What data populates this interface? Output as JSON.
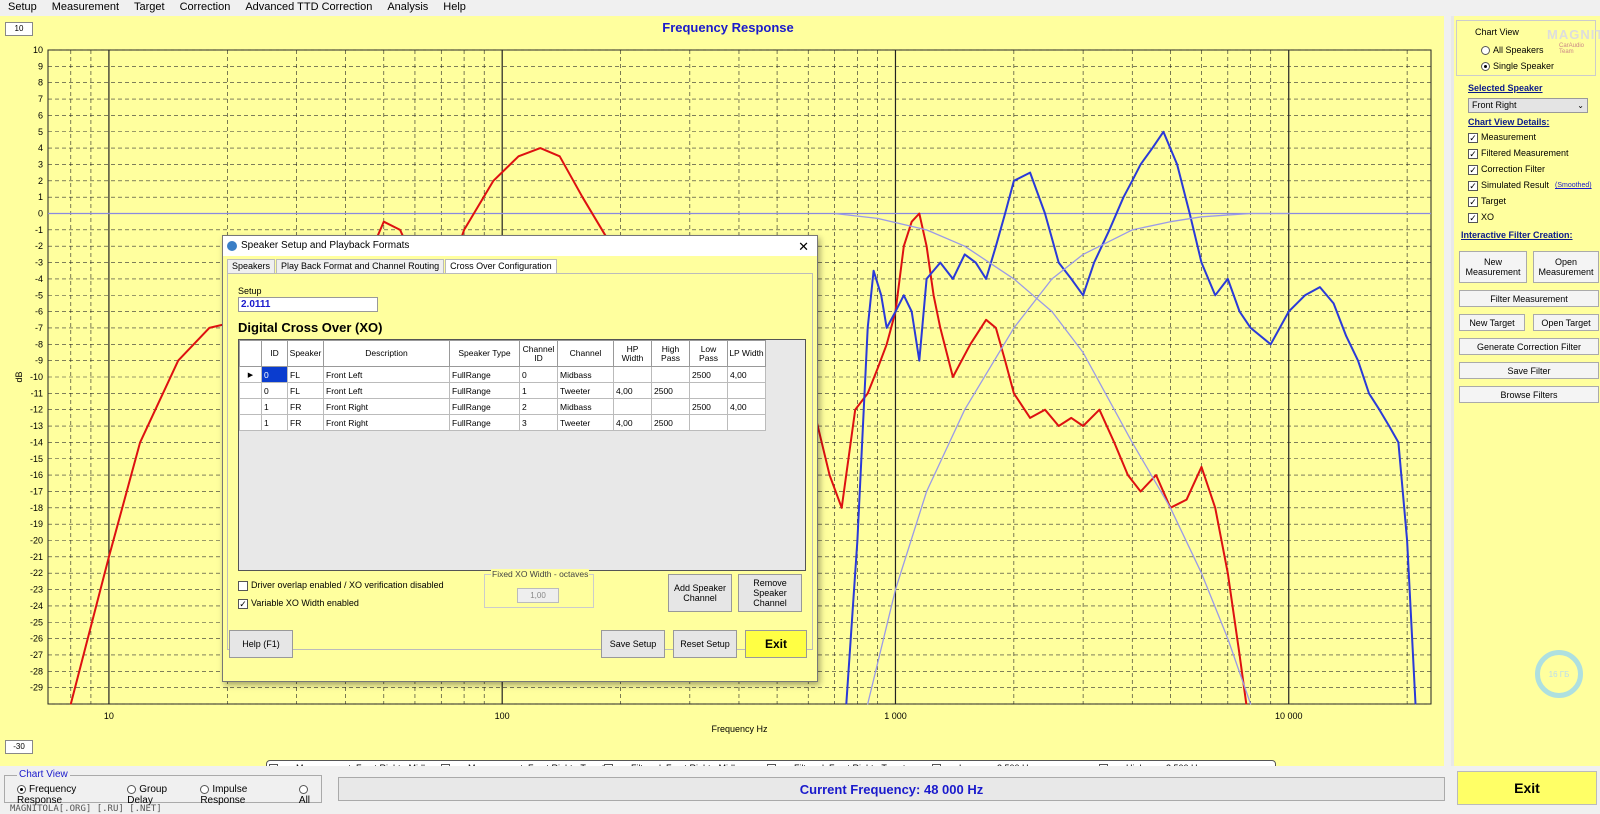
{
  "menu": [
    "Setup",
    "Measurement",
    "Target",
    "Correction",
    "Advanced TTD Correction",
    "Analysis",
    "Help"
  ],
  "chart": {
    "title": "Frequency Response",
    "ymax_box": "10",
    "ymin_box": "-30",
    "ylabel": "dB",
    "xlabel": "Frequency Hz",
    "y_ticks": [
      "10",
      "9",
      "8",
      "7",
      "6",
      "5",
      "4",
      "3",
      "2",
      "1",
      "0",
      "-1",
      "-2",
      "-3",
      "-4",
      "-5",
      "-6",
      "-7",
      "-8",
      "-9",
      "-10",
      "-11",
      "-12",
      "-13",
      "-14",
      "-15",
      "-16",
      "-17",
      "-18",
      "-19",
      "-20",
      "-21",
      "-22",
      "-23",
      "-24",
      "-25",
      "-26",
      "-27",
      "-28",
      "-29"
    ],
    "x_ticks": [
      "10",
      "100",
      "1 000",
      "10 000"
    ]
  },
  "chart_data": {
    "type": "line",
    "title": "Frequency Response",
    "xlabel": "Frequency Hz",
    "ylabel": "dB",
    "x_scale": "log",
    "xlim": [
      7,
      23000
    ],
    "ylim": [
      -30,
      10
    ],
    "grid": true,
    "legend_position": "bottom",
    "series": [
      {
        "name": "Filtered: Front Right - Midbass",
        "color": "#dd1111",
        "x": [
          8,
          10,
          12,
          15,
          18,
          22,
          26,
          34,
          42,
          46,
          50,
          55,
          60,
          65,
          70,
          80,
          95,
          110,
          125,
          140,
          160,
          190,
          230,
          280,
          330,
          400,
          480,
          560,
          620,
          680,
          730,
          790,
          850,
          900,
          950,
          1000,
          1050,
          1100,
          1150,
          1200,
          1250,
          1300,
          1400,
          1550,
          1700,
          1800,
          1900,
          2000,
          2200,
          2400,
          2600,
          2800,
          3000,
          3300,
          3600,
          3900,
          4200,
          4600,
          5000,
          5500,
          6000,
          6500,
          7000,
          7500,
          7800
        ],
        "y": [
          -30,
          -21,
          -14,
          -9,
          -7,
          -6.5,
          -6.3,
          -6.8,
          -4.5,
          -2.5,
          -0.5,
          -1,
          -3,
          -5,
          -5,
          -1,
          2,
          3.5,
          4,
          3.5,
          1,
          -2,
          -5,
          -9,
          -12,
          -14,
          -15,
          -14,
          -12,
          -16,
          -18,
          -12,
          -11,
          -9.5,
          -8,
          -6,
          -2,
          -0.5,
          0,
          -2,
          -5,
          -7,
          -10,
          -8,
          -6.5,
          -7,
          -9,
          -11,
          -12.5,
          -12,
          -13,
          -12.5,
          -13,
          -12,
          -14,
          -16,
          -17,
          -16,
          -18,
          -17.5,
          -15.5,
          -18,
          -22,
          -27,
          -30
        ]
      },
      {
        "name": "Filtered: Front Right - Tweeter",
        "color": "#2a3ad8",
        "x": [
          750,
          800,
          850,
          880,
          920,
          950,
          1000,
          1050,
          1100,
          1150,
          1200,
          1300,
          1400,
          1500,
          1600,
          1700,
          1800,
          1900,
          2000,
          2200,
          2400,
          2600,
          2800,
          3000,
          3200,
          3500,
          3800,
          4000,
          4200,
          4500,
          4800,
          5200,
          5600,
          6000,
          6500,
          7000,
          7500,
          8000,
          9000,
          10000,
          11000,
          12000,
          13000,
          14000,
          15000,
          16000,
          17000,
          18000,
          19000,
          20000,
          21000
        ],
        "y": [
          -30,
          -20,
          -7,
          -3.5,
          -5,
          -7,
          -6,
          -5,
          -6,
          -9,
          -4,
          -3,
          -4,
          -2.5,
          -3,
          -4,
          -2,
          0,
          2,
          2.5,
          0,
          -3,
          -4,
          -5,
          -3,
          -1,
          1,
          2,
          3,
          4,
          5,
          3,
          0,
          -3,
          -5,
          -4,
          -6,
          -7,
          -8,
          -6,
          -5,
          -4.5,
          -5.5,
          -7.5,
          -9,
          -11,
          -12,
          -13,
          -14,
          -20,
          -30
        ]
      },
      {
        "name": "Lowpass 2 500 Hz",
        "color": "#9a9ae8",
        "x": [
          700,
          900,
          1200,
          1500,
          2000,
          2500,
          3000,
          4000,
          5000,
          6000,
          7000,
          8000
        ],
        "y": [
          0,
          -0.3,
          -1,
          -2,
          -4,
          -6,
          -8.5,
          -14,
          -18,
          -22,
          -26,
          -30
        ]
      },
      {
        "name": "Highpass 2 500 Hz",
        "color": "#9a9ae8",
        "x": [
          850,
          1000,
          1200,
          1500,
          2000,
          2500,
          3000,
          4000,
          5000,
          6000,
          8000,
          10000
        ],
        "y": [
          -30,
          -23,
          -17,
          -12,
          -7,
          -4,
          -2.5,
          -1,
          -0.5,
          -0.2,
          0,
          0
        ]
      }
    ]
  },
  "legend": [
    {
      "label": "Measurement: Front Right - Midbass",
      "color": "#f0c0a0"
    },
    {
      "label": "Measurement: Front Right - Tweeter",
      "color": "#b0b0e8"
    },
    {
      "label": "Filtered: Front Right - Midbass",
      "color": "#dd1111"
    },
    {
      "label": "Filtered: Front Right - Tweeter",
      "color": "#2a3ad8"
    },
    {
      "label": "Lowpass 2 500 Hz",
      "color": "#b0b0e8"
    },
    {
      "label": "Highpass 2 500 Hz",
      "color": "#b0b0e8"
    }
  ],
  "right": {
    "brand": "MAGNITOLA",
    "brand_sub": "CarAudio Team",
    "chart_view_title": "Chart View",
    "all_speakers": "All Speakers",
    "single_speaker": "Single Speaker",
    "selected_speaker_head": "Selected Speaker",
    "selected_speaker": "Front Right",
    "details_head": "Chart View Details:",
    "details": [
      "Measurement",
      "Filtered Measurement",
      "Correction Filter",
      "Simulated Result",
      "Target",
      "XO"
    ],
    "smoothed": "(Smoothed)",
    "interactive_head": "Interactive Filter Creation:",
    "new_measurement": "New Measurement",
    "open_measurement": "Open Measurement",
    "filter_measurement": "Filter Measurement",
    "new_target": "New Target",
    "open_target": "Open Target",
    "generate": "Generate Correction Filter",
    "save_filter": "Save Filter",
    "browse": "Browse Filters"
  },
  "bottom": {
    "chart_view": "Chart View",
    "options": [
      "Frequency Response",
      "Group Delay",
      "Impulse Response",
      "All"
    ],
    "current_frequency": "Current Frequency: 48 000 Hz",
    "exit": "Exit",
    "footer": "MAGNITOLA[.ORG] [.RU] [.NET]"
  },
  "dialog": {
    "title": "Speaker Setup and Playback Formats",
    "tabs": [
      "Speakers",
      "Play Back Format and Channel Routing",
      "Cross Over Configuration"
    ],
    "setup_label": "Setup",
    "setup_value": "2.0111",
    "xo_title": "Digital Cross Over (XO)",
    "columns": [
      "ID",
      "Speaker",
      "Description",
      "Speaker Type",
      "Channel ID",
      "Channel",
      "HP Width",
      "High Pass",
      "Low Pass",
      "LP Width"
    ],
    "rows": [
      [
        "0",
        "FL",
        "Front Left",
        "FullRange",
        "0",
        "Midbass",
        "",
        "",
        "2500",
        "4,00"
      ],
      [
        "0",
        "FL",
        "Front Left",
        "FullRange",
        "1",
        "Tweeter",
        "4,00",
        "2500",
        "",
        ""
      ],
      [
        "1",
        "FR",
        "Front Right",
        "FullRange",
        "2",
        "Midbass",
        "",
        "",
        "2500",
        "4,00"
      ],
      [
        "1",
        "FR",
        "Front Right",
        "FullRange",
        "3",
        "Tweeter",
        "4,00",
        "2500",
        "",
        ""
      ]
    ],
    "overlap": "Driver overlap enabled / XO verification disabled",
    "variable": "Variable XO Width enabled",
    "fixed_label": "Fixed XO Width - octaves",
    "fixed_value": "1,00",
    "add_channel": "Add Speaker Channel",
    "remove_channel": "Remove Speaker Channel",
    "help": "Help (F1)",
    "save": "Save Setup",
    "reset": "Reset Setup",
    "exit": "Exit"
  },
  "badge": "16 ГБ"
}
